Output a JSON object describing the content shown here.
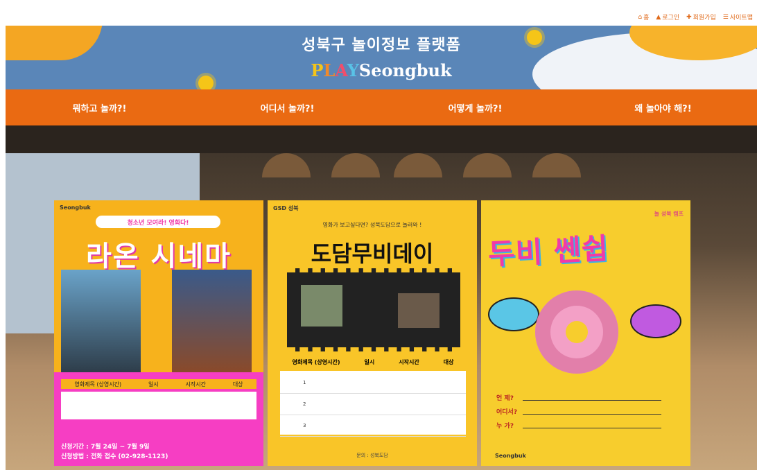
{
  "top_links": [
    {
      "icon": "home-icon",
      "label": "홈"
    },
    {
      "icon": "login-icon",
      "label": "로그인"
    },
    {
      "icon": "join-icon",
      "label": "회원가입"
    },
    {
      "icon": "sitemap-icon",
      "label": "사이트맵"
    }
  ],
  "header": {
    "title": "성북구 놀이정보 플랫폼",
    "logo_letters": [
      "P",
      "L",
      "A",
      "Y"
    ],
    "logo_suffix": "Seongbuk"
  },
  "nav": [
    "뭐하고 놀까?!",
    "어디서 놀까?!",
    "어떻게 놀까?!",
    "왜 놀아야 해?!"
  ],
  "posters": [
    {
      "brand": "Seongbuk",
      "tag": "청소년 모여라! 영화다!",
      "title": "라온 시네마",
      "table_headers": [
        "영화제목 (상영시간)",
        "일시",
        "시작시간",
        "대상"
      ],
      "period": "신청기간 : 7월 24일 ~ 7월 9일",
      "apply": "신청방법 : 전화 접수 (02-928-1123)"
    },
    {
      "brand": "GSD 성북",
      "subtitle": "영화가 보고싶다면? 성북도담으로 놀러와 !",
      "title": "도담무비데이",
      "table_headers": [
        "영화제목 (상영시간)",
        "일시",
        "시작시간",
        "대상"
      ],
      "rows": [
        "1",
        "2",
        "3"
      ],
      "footer": "문의 : 성북도담"
    },
    {
      "brand": "Seongbuk",
      "corner": "놀 성북 캠프",
      "title": "두비 쎈쉽",
      "questions": [
        "언 제?",
        "어디서?",
        "누 가?"
      ]
    }
  ],
  "colors": {
    "nav_bg": "#ea6a12",
    "banner_bg": "#5a86b8",
    "accent": "#e06a1a"
  }
}
